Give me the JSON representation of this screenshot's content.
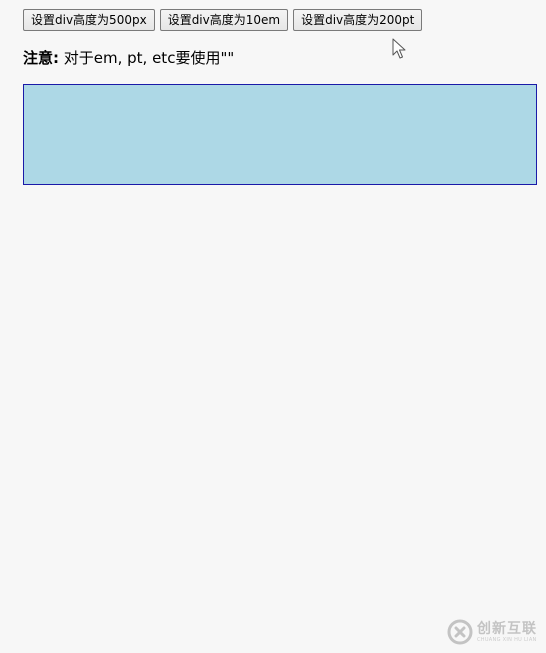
{
  "toolbar": {
    "buttons": [
      {
        "label": "设置div高度为500px"
      },
      {
        "label": "设置div高度为10em"
      },
      {
        "label": "设置div高度为200pt"
      }
    ]
  },
  "note": {
    "bold_label": "注意:",
    "text": " 对于em, pt, etc要使用\"\""
  },
  "colors": {
    "page_background": "#f7f7f7",
    "box_fill": "#add8e6",
    "box_border": "#1a1aa8"
  },
  "watermark": {
    "main_text": "创新互联",
    "sub_text": "CHUANG XIN HU LIAN"
  }
}
